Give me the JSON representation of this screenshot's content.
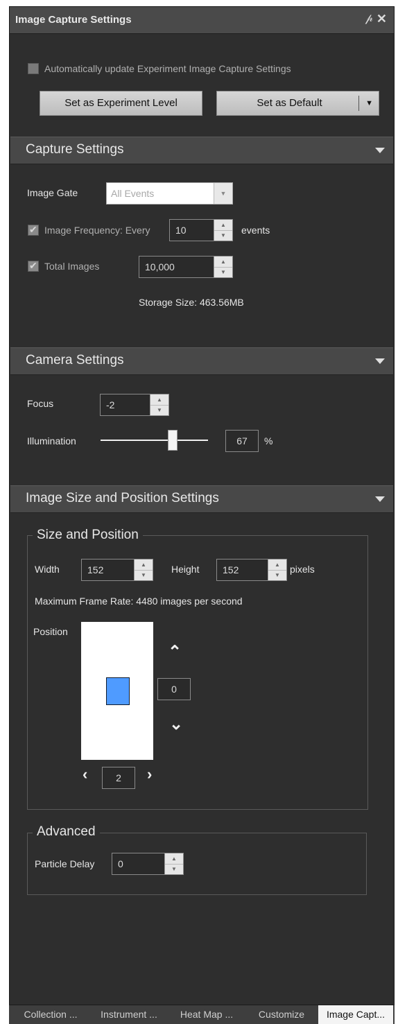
{
  "window": {
    "title": "Image Capture Settings",
    "pin_glyph": "§",
    "close_glyph": "✕"
  },
  "top": {
    "auto_update_label": "Automatically update Experiment Image Capture Settings",
    "auto_update_checked": false,
    "set_experiment_label": "Set as Experiment Level",
    "set_default_label": "Set as Default"
  },
  "capture": {
    "title": "Capture Settings",
    "image_gate_label": "Image Gate",
    "image_gate_value": "All Events",
    "freq_label": "Image Frequency: Every",
    "freq_value": "10",
    "freq_unit": "events",
    "total_label": "Total Images",
    "total_value": "10,000",
    "storage_label": "Storage Size: 463.56MB"
  },
  "camera": {
    "title": "Camera Settings",
    "focus_label": "Focus",
    "focus_value": "-2",
    "illum_label": "Illumination",
    "illum_value": "67",
    "illum_unit": "%",
    "illum_level": 0.67
  },
  "imagesize": {
    "title": "Image Size and Position Settings",
    "group_title": "Size and Position",
    "width_label": "Width",
    "width_value": "152",
    "height_label": "Height",
    "height_value": "152",
    "unit": "pixels",
    "max_frame_label": "Maximum Frame Rate: 4480 images per second",
    "position_label": "Position",
    "pos_vertical": "0",
    "pos_horizontal": "2"
  },
  "advanced": {
    "group_title": "Advanced",
    "particle_delay_label": "Particle Delay",
    "particle_delay_value": "0"
  },
  "tabs": [
    "Collection ...",
    "Instrument ...",
    "Heat Map ...",
    "Customize",
    "Image Capt..."
  ],
  "colors": {
    "panel_bg": "#2e2e2e",
    "header_bg": "#484848",
    "marker": "#4f9bff"
  }
}
